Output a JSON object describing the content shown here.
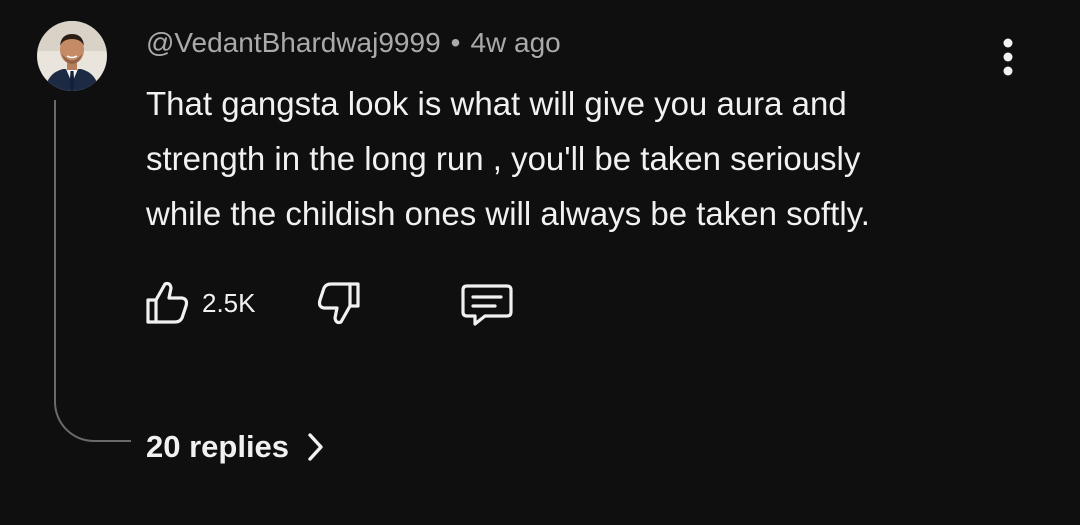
{
  "comment": {
    "author": "@VedantBhardwaj9999",
    "separator": "•",
    "time_ago": "4w ago",
    "text_lines": [
      "That gangsta look is what will give you aura and",
      "strength in the long run , you'll be taken seriously",
      "while the childish ones will always be taken softly."
    ],
    "like_count": "2.5K",
    "icons": {
      "avatar": "avatar",
      "menu": "more-vertical-icon",
      "like": "thumbs-up-icon",
      "dislike": "thumbs-down-icon",
      "reply": "comment-icon",
      "chevron": "chevron-right-icon"
    }
  },
  "replies": {
    "label": "20 replies"
  },
  "colors": {
    "background": "#0f0f0f",
    "primary_text": "#f1f1f1",
    "secondary_text": "#aaaaaa",
    "thread_line": "#6a6a6a"
  }
}
